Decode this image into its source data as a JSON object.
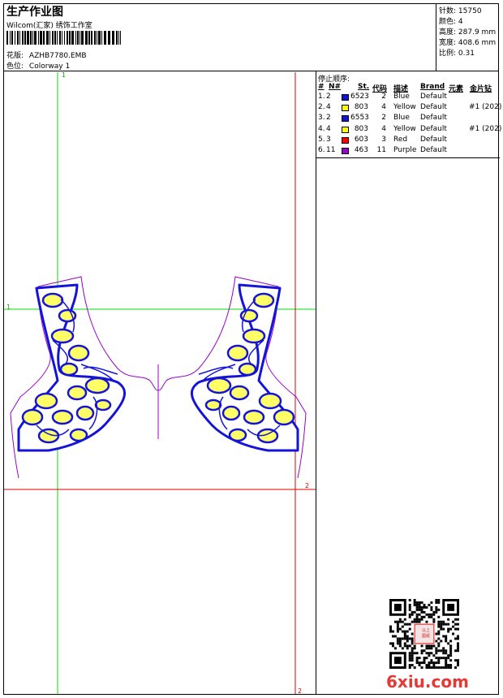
{
  "header": {
    "title": "生产作业图",
    "subtitle": "Wilcom(汇家) 绣饰工作室",
    "pattern_label": "花版:",
    "pattern_value": "AZHB7780.EMB",
    "color_label": "色位:",
    "color_value": "Colorway 1"
  },
  "stats": [
    {
      "label": "针数:",
      "value": "15750"
    },
    {
      "label": "颜色:",
      "value": "4"
    },
    {
      "label": "高度:",
      "value": "287.9 mm"
    },
    {
      "label": "宽度:",
      "value": "408.6 mm"
    },
    {
      "label": "比例:",
      "value": "0.31"
    }
  ],
  "stop_sequence": {
    "title": "停止顺序:",
    "columns": [
      "#",
      "N#",
      "St.",
      "代码",
      "描述",
      "Brand",
      "元素",
      "金片钻"
    ],
    "rows": [
      {
        "num": "1.",
        "needle": "2",
        "swatch": "#1414d8",
        "stitches": "6523",
        "code": "2",
        "desc": "Blue",
        "brand": "Default",
        "element": "",
        "sequin": ""
      },
      {
        "num": "2.",
        "needle": "4",
        "swatch": "#ffff00",
        "stitches": "803",
        "code": "4",
        "desc": "Yellow",
        "brand": "Default",
        "element": "",
        "sequin": "#1 (202)"
      },
      {
        "num": "3.",
        "needle": "2",
        "swatch": "#1414d8",
        "stitches": "6553",
        "code": "2",
        "desc": "Blue",
        "brand": "Default",
        "element": "",
        "sequin": ""
      },
      {
        "num": "4.",
        "needle": "4",
        "swatch": "#ffff00",
        "stitches": "803",
        "code": "4",
        "desc": "Yellow",
        "brand": "Default",
        "element": "",
        "sequin": "#1 (202)"
      },
      {
        "num": "5.",
        "needle": "3",
        "swatch": "#ff0000",
        "stitches": "603",
        "code": "3",
        "desc": "Red",
        "brand": "Default",
        "element": "",
        "sequin": ""
      },
      {
        "num": "6.",
        "needle": "11",
        "swatch": "#9900cc",
        "stitches": "463",
        "code": "11",
        "desc": "Purple",
        "brand": "Default",
        "element": "",
        "sequin": ""
      }
    ]
  },
  "guides": {
    "v1": "1",
    "h1": "1",
    "h2": "2",
    "v2": "2"
  },
  "watermark": "6xiu.com",
  "stamp_text": "以上图纸",
  "colors": {
    "blue": "#1414d8",
    "yellow": "#ffff66",
    "red": "#ff0000",
    "purple": "#9900cc",
    "green": "#00dd00"
  }
}
